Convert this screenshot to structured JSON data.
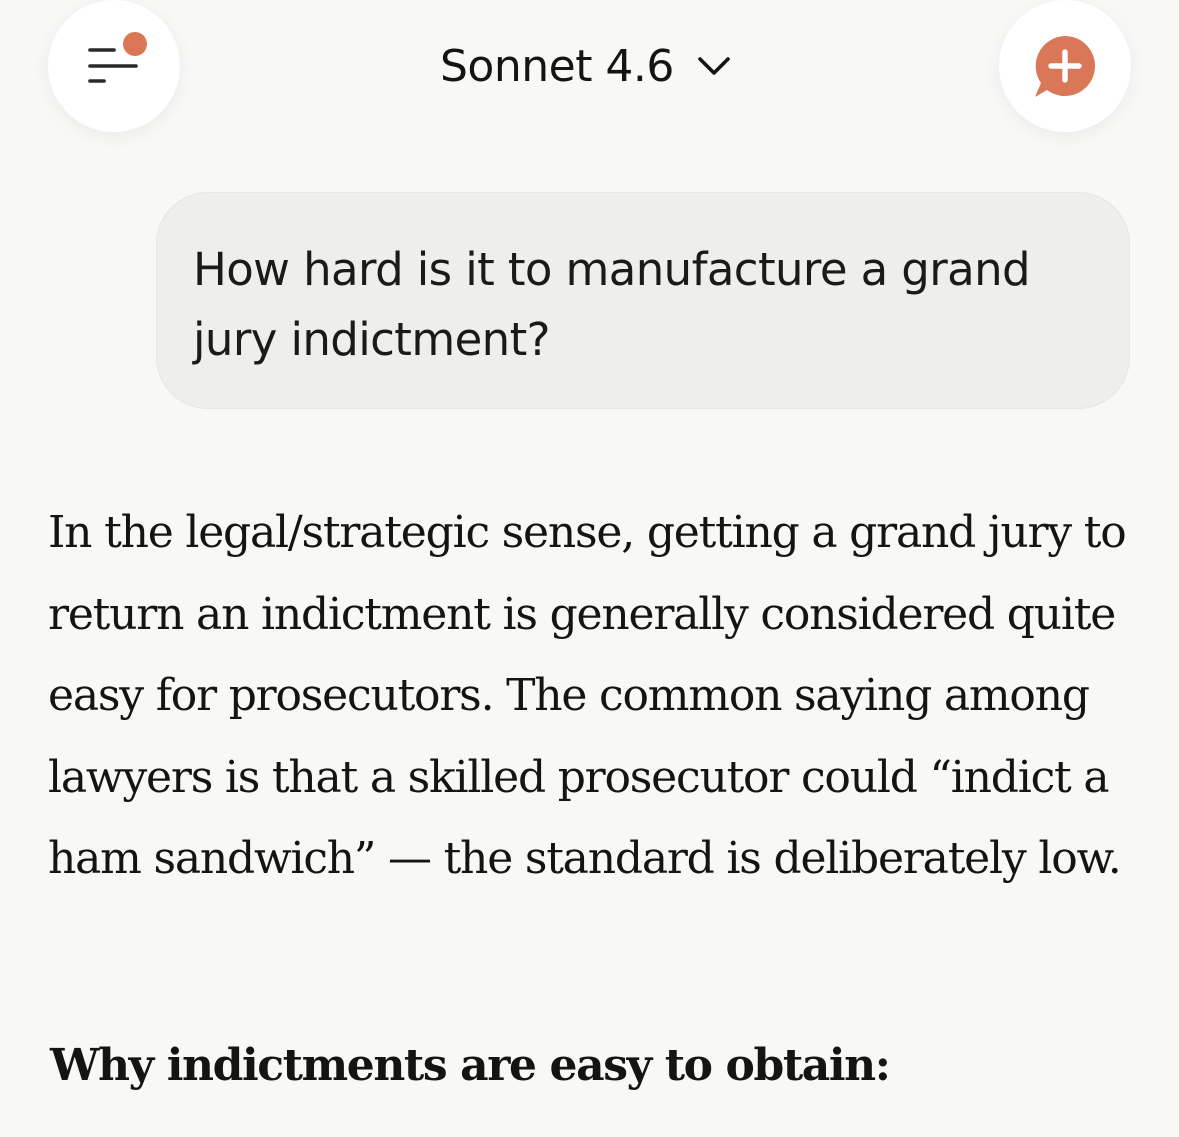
{
  "header": {
    "model_name": "Sonnet 4.6",
    "menu_icon": "menu-lines-icon",
    "chevron_icon": "chevron-down-icon",
    "new_chat_icon": "new-chat-plus-icon",
    "notification_dot_color": "#d97757",
    "accent_color": "#d97757"
  },
  "conversation": {
    "user_message": "How hard is it to manufacture a grand jury indictment?",
    "assistant_paragraph": "In the legal/strategic sense, getting a grand jury to return an indictment is generally considered quite easy for prosecutors. The common saying among lawyers is that a skilled prosecutor could “indict a ham sandwich” — the standard is deliberately low.",
    "assistant_heading": "Why indictments are easy to obtain:"
  }
}
